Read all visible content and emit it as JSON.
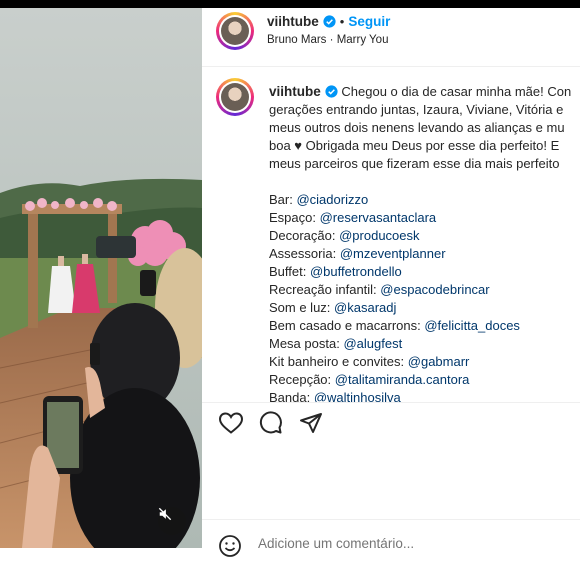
{
  "post": {
    "username": "viihtube",
    "follow_label": "Seguir",
    "separator": "•",
    "music": {
      "artist": "Bruno Mars",
      "song": "Marry You",
      "separator": "·"
    }
  },
  "caption": {
    "lines": [
      "Chegou o dia de casar minha mãe! Con",
      "gerações entrando juntas, Izaura, Viviane, Vitória e",
      "meus outros dois nenens levando as alianças e mu",
      "boa ♥ Obrigada meu Deus por esse dia perfeito! E",
      "meus parceiros que fizeram esse dia mais perfeito"
    ],
    "credits": [
      {
        "label": "Bar:",
        "handle": "@ciadorizzo"
      },
      {
        "label": "Espaço:",
        "handle": "@reservasantaclara"
      },
      {
        "label": "Decoração:",
        "handle": "@producoesk"
      },
      {
        "label": "Assessoria:",
        "handle": "@mzeventplanner"
      },
      {
        "label": "Buffet:",
        "handle": "@buffetrondello"
      },
      {
        "label": "Recreação infantil:",
        "handle": "@espacodebrincar"
      },
      {
        "label": "Som e luz:",
        "handle": "@kasaradj"
      },
      {
        "label": "Bem casado e macarrons:",
        "handle": "@felicitta_doces"
      },
      {
        "label": "Mesa posta:",
        "handle": "@alugfest"
      },
      {
        "label": "Kit banheiro e convites:",
        "handle": "@gabmarr"
      },
      {
        "label": "Recepção:",
        "handle": "@talitamiranda.cantora"
      },
      {
        "label": "Banda:",
        "handle": "@waltinhosilva"
      }
    ]
  },
  "comment": {
    "placeholder": "Adicione um comentário..."
  },
  "icons": {
    "like": "heart-icon",
    "comment": "comment-icon",
    "share": "share-icon",
    "emoji": "emoji-icon",
    "mute": "muted-speaker-icon",
    "verified": "verified-badge-icon"
  },
  "colors": {
    "link": "#00376b",
    "follow": "#0095f6",
    "text": "#262626",
    "muted": "#8e8e8e",
    "verified": "#0095f6"
  }
}
